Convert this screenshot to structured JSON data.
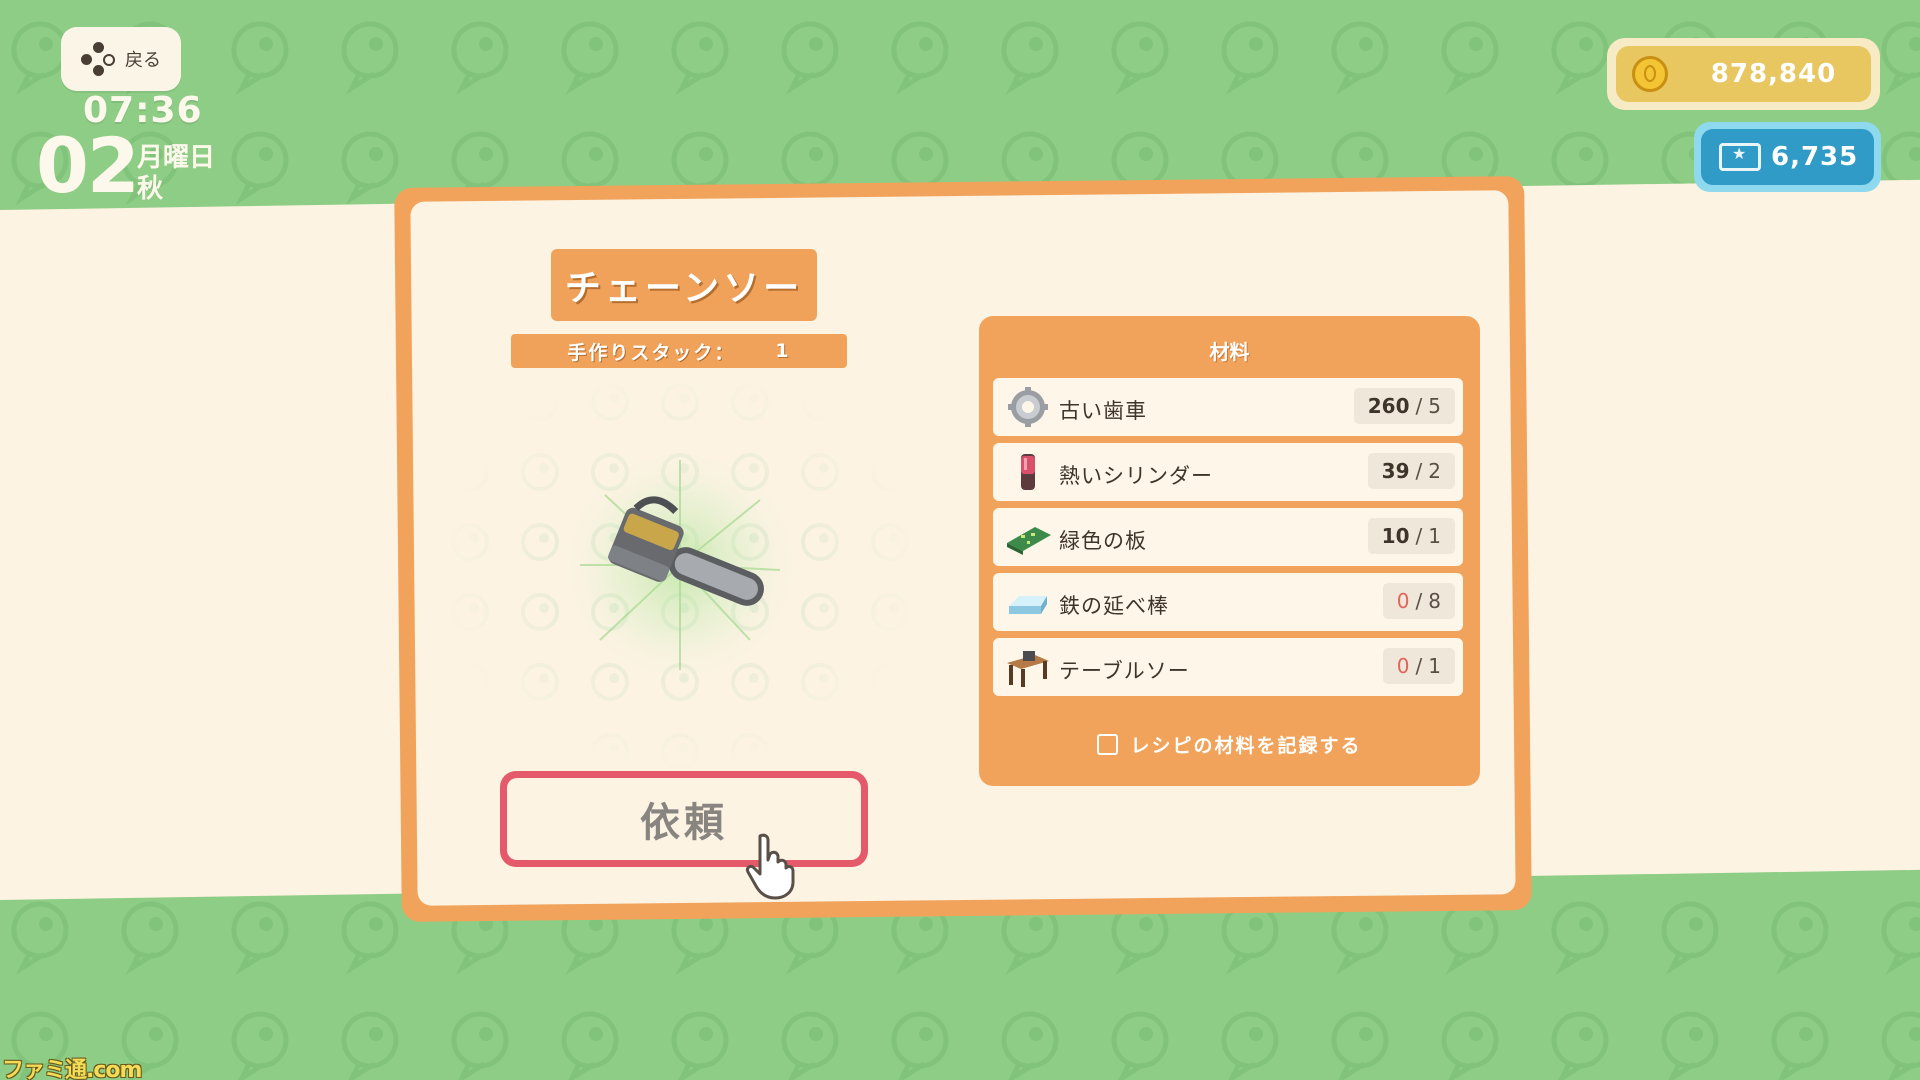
{
  "hud": {
    "back_label": "戻る",
    "time": "07:36",
    "day": "02",
    "weekday": "月曜日",
    "season": "秋"
  },
  "currency": {
    "gold": "878,840",
    "tickets": "6,735"
  },
  "recipe": {
    "title": "チェーンソー",
    "stack_label": "手作りスタック：",
    "stack_value": "1",
    "item_icon": "chainsaw-icon",
    "request_label": "依頼"
  },
  "materials": {
    "title": "材料",
    "items": [
      {
        "name": "古い歯車",
        "have": "260",
        "need": "5",
        "icon": "gear-icon",
        "sufficient": true
      },
      {
        "name": "熱いシリンダー",
        "have": "39",
        "need": "2",
        "icon": "cylinder-icon",
        "sufficient": true
      },
      {
        "name": "緑色の板",
        "have": "10",
        "need": "1",
        "icon": "green-board-icon",
        "sufficient": true
      },
      {
        "name": "鉄の延べ棒",
        "have": "0",
        "need": "8",
        "icon": "iron-bar-icon",
        "sufficient": false
      },
      {
        "name": "テーブルソー",
        "have": "0",
        "need": "1",
        "icon": "table-saw-icon",
        "sufficient": false
      }
    ],
    "record_label": "レシピの材料を記録する",
    "separator": "/"
  },
  "watermark": "ファミ通.com",
  "colors": {
    "background_green": "#8ecd85",
    "panel_orange": "#f1a35b",
    "panel_cream": "#fcf3e3",
    "request_border": "#e45a6b",
    "gold": "#e8c760",
    "ticket_blue": "#2f9bc6",
    "shortage_red": "#e4645a"
  }
}
